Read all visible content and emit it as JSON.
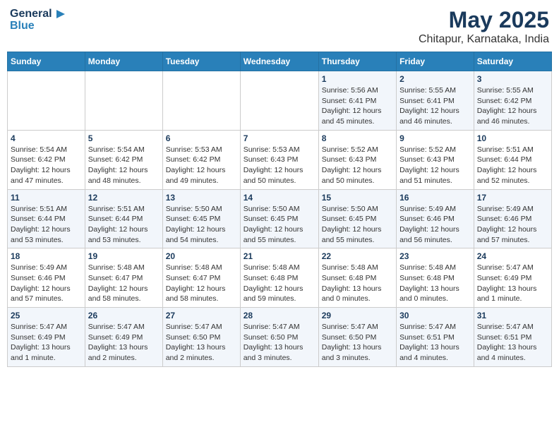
{
  "logo": {
    "line1": "General",
    "line2": "Blue"
  },
  "title": "May 2025",
  "subtitle": "Chitapur, Karnataka, India",
  "days_of_week": [
    "Sunday",
    "Monday",
    "Tuesday",
    "Wednesday",
    "Thursday",
    "Friday",
    "Saturday"
  ],
  "weeks": [
    [
      {
        "day": "",
        "info": ""
      },
      {
        "day": "",
        "info": ""
      },
      {
        "day": "",
        "info": ""
      },
      {
        "day": "",
        "info": ""
      },
      {
        "day": "1",
        "info": "Sunrise: 5:56 AM\nSunset: 6:41 PM\nDaylight: 12 hours\nand 45 minutes."
      },
      {
        "day": "2",
        "info": "Sunrise: 5:55 AM\nSunset: 6:41 PM\nDaylight: 12 hours\nand 46 minutes."
      },
      {
        "day": "3",
        "info": "Sunrise: 5:55 AM\nSunset: 6:42 PM\nDaylight: 12 hours\nand 46 minutes."
      }
    ],
    [
      {
        "day": "4",
        "info": "Sunrise: 5:54 AM\nSunset: 6:42 PM\nDaylight: 12 hours\nand 47 minutes."
      },
      {
        "day": "5",
        "info": "Sunrise: 5:54 AM\nSunset: 6:42 PM\nDaylight: 12 hours\nand 48 minutes."
      },
      {
        "day": "6",
        "info": "Sunrise: 5:53 AM\nSunset: 6:42 PM\nDaylight: 12 hours\nand 49 minutes."
      },
      {
        "day": "7",
        "info": "Sunrise: 5:53 AM\nSunset: 6:43 PM\nDaylight: 12 hours\nand 50 minutes."
      },
      {
        "day": "8",
        "info": "Sunrise: 5:52 AM\nSunset: 6:43 PM\nDaylight: 12 hours\nand 50 minutes."
      },
      {
        "day": "9",
        "info": "Sunrise: 5:52 AM\nSunset: 6:43 PM\nDaylight: 12 hours\nand 51 minutes."
      },
      {
        "day": "10",
        "info": "Sunrise: 5:51 AM\nSunset: 6:44 PM\nDaylight: 12 hours\nand 52 minutes."
      }
    ],
    [
      {
        "day": "11",
        "info": "Sunrise: 5:51 AM\nSunset: 6:44 PM\nDaylight: 12 hours\nand 53 minutes."
      },
      {
        "day": "12",
        "info": "Sunrise: 5:51 AM\nSunset: 6:44 PM\nDaylight: 12 hours\nand 53 minutes."
      },
      {
        "day": "13",
        "info": "Sunrise: 5:50 AM\nSunset: 6:45 PM\nDaylight: 12 hours\nand 54 minutes."
      },
      {
        "day": "14",
        "info": "Sunrise: 5:50 AM\nSunset: 6:45 PM\nDaylight: 12 hours\nand 55 minutes."
      },
      {
        "day": "15",
        "info": "Sunrise: 5:50 AM\nSunset: 6:45 PM\nDaylight: 12 hours\nand 55 minutes."
      },
      {
        "day": "16",
        "info": "Sunrise: 5:49 AM\nSunset: 6:46 PM\nDaylight: 12 hours\nand 56 minutes."
      },
      {
        "day": "17",
        "info": "Sunrise: 5:49 AM\nSunset: 6:46 PM\nDaylight: 12 hours\nand 57 minutes."
      }
    ],
    [
      {
        "day": "18",
        "info": "Sunrise: 5:49 AM\nSunset: 6:46 PM\nDaylight: 12 hours\nand 57 minutes."
      },
      {
        "day": "19",
        "info": "Sunrise: 5:48 AM\nSunset: 6:47 PM\nDaylight: 12 hours\nand 58 minutes."
      },
      {
        "day": "20",
        "info": "Sunrise: 5:48 AM\nSunset: 6:47 PM\nDaylight: 12 hours\nand 58 minutes."
      },
      {
        "day": "21",
        "info": "Sunrise: 5:48 AM\nSunset: 6:48 PM\nDaylight: 12 hours\nand 59 minutes."
      },
      {
        "day": "22",
        "info": "Sunrise: 5:48 AM\nSunset: 6:48 PM\nDaylight: 13 hours\nand 0 minutes."
      },
      {
        "day": "23",
        "info": "Sunrise: 5:48 AM\nSunset: 6:48 PM\nDaylight: 13 hours\nand 0 minutes."
      },
      {
        "day": "24",
        "info": "Sunrise: 5:47 AM\nSunset: 6:49 PM\nDaylight: 13 hours\nand 1 minute."
      }
    ],
    [
      {
        "day": "25",
        "info": "Sunrise: 5:47 AM\nSunset: 6:49 PM\nDaylight: 13 hours\nand 1 minute."
      },
      {
        "day": "26",
        "info": "Sunrise: 5:47 AM\nSunset: 6:49 PM\nDaylight: 13 hours\nand 2 minutes."
      },
      {
        "day": "27",
        "info": "Sunrise: 5:47 AM\nSunset: 6:50 PM\nDaylight: 13 hours\nand 2 minutes."
      },
      {
        "day": "28",
        "info": "Sunrise: 5:47 AM\nSunset: 6:50 PM\nDaylight: 13 hours\nand 3 minutes."
      },
      {
        "day": "29",
        "info": "Sunrise: 5:47 AM\nSunset: 6:50 PM\nDaylight: 13 hours\nand 3 minutes."
      },
      {
        "day": "30",
        "info": "Sunrise: 5:47 AM\nSunset: 6:51 PM\nDaylight: 13 hours\nand 4 minutes."
      },
      {
        "day": "31",
        "info": "Sunrise: 5:47 AM\nSunset: 6:51 PM\nDaylight: 13 hours\nand 4 minutes."
      }
    ]
  ]
}
